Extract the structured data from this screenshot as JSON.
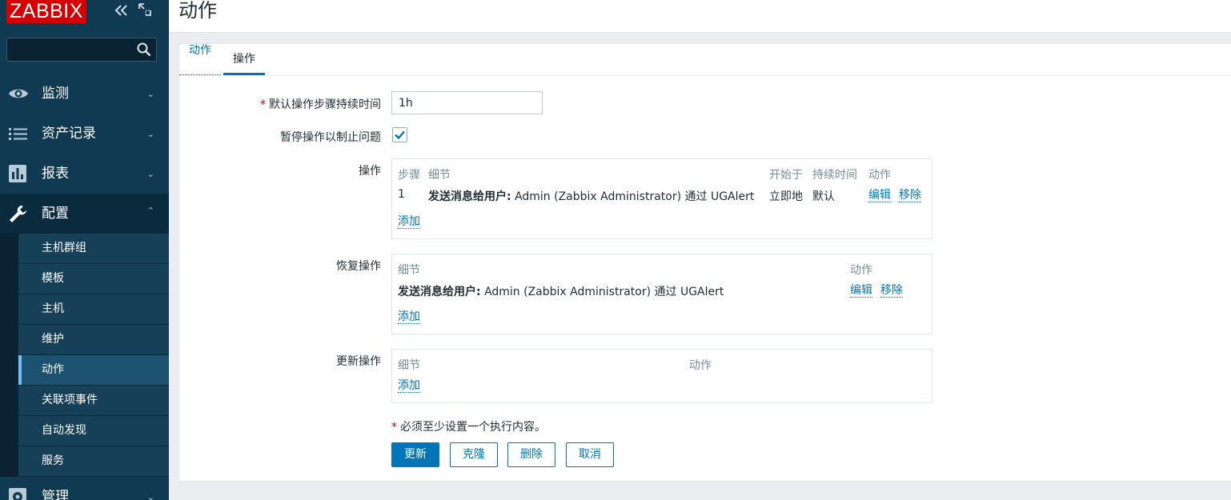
{
  "sidebar": {
    "logo": "ZABBIX",
    "search_placeholder": "",
    "menu": [
      {
        "label": "监测",
        "icon": "eye-icon"
      },
      {
        "label": "资产记录",
        "icon": "list-icon"
      },
      {
        "label": "报表",
        "icon": "bar-chart-icon"
      },
      {
        "label": "配置",
        "icon": "wrench-icon"
      },
      {
        "label": "管理",
        "icon": "gear-icon"
      }
    ],
    "submenu": [
      "主机群组",
      "模板",
      "主机",
      "维护",
      "动作",
      "关联项事件",
      "自动发现",
      "服务"
    ]
  },
  "header": {
    "title": "动作"
  },
  "tabs": [
    "动作",
    "操作"
  ],
  "form": {
    "default_duration_label": "默认操作步骤持续时间",
    "default_duration_value": "1h",
    "pause_label": "暂停操作以制止问题",
    "operations_label": "操作",
    "recovery_label": "恢复操作",
    "update_label": "更新操作",
    "required_note": "必须至少设置一个执行内容。"
  },
  "operations": {
    "headers": {
      "step": "步骤",
      "details": "细节",
      "start": "开始于",
      "duration": "持续时间",
      "action": "动作"
    },
    "rows": [
      {
        "step": "1",
        "details_bold": "发送消息给用户:",
        "details": "Admin (Zabbix Administrator) 通过 UGAlert",
        "start": "立即地",
        "duration": "默认",
        "edit": "编辑",
        "remove": "移除"
      }
    ],
    "add": "添加"
  },
  "recovery": {
    "headers": {
      "details": "细节",
      "action": "动作"
    },
    "rows": [
      {
        "details_bold": "发送消息给用户:",
        "details": "Admin (Zabbix Administrator) 通过 UGAlert",
        "edit": "编辑",
        "remove": "移除"
      }
    ],
    "add": "添加"
  },
  "update_ops": {
    "headers": {
      "details": "细节",
      "action": "动作"
    },
    "add": "添加"
  },
  "buttons": {
    "update": "更新",
    "clone": "克隆",
    "delete": "删除",
    "cancel": "取消"
  },
  "colors": {
    "sidebar": "#0f3a52",
    "accent": "#0275b8",
    "logo": "#d40000"
  }
}
